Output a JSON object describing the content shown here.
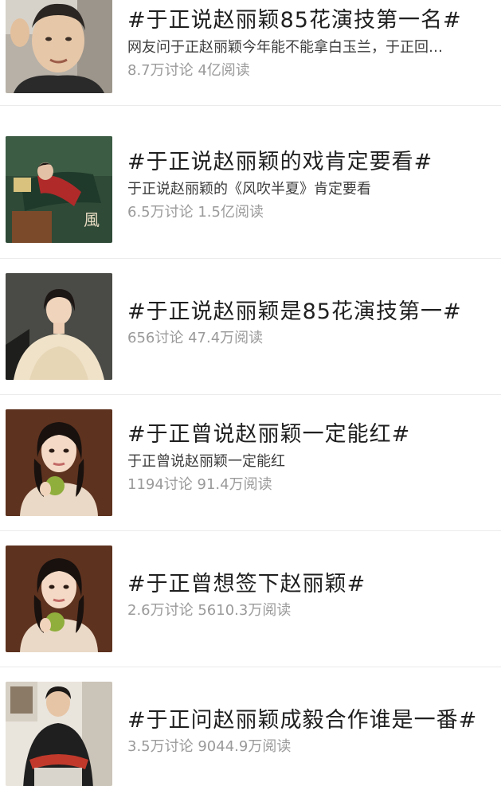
{
  "topics": [
    {
      "title": "#于正说赵丽颖85花演技第一名#",
      "desc": "网友问于正赵丽颖今年能不能拿白玉兰，于正回…",
      "stats": "8.7万讨论 4亿阅读",
      "thumb": "portrait-man-selfie"
    },
    {
      "title": "#于正说赵丽颖的戏肯定要看#",
      "desc": "于正说赵丽颖的《风吹半夏》肯定要看",
      "stats": "6.5万讨论 1.5亿阅读",
      "thumb": "drama-poster"
    },
    {
      "title": "#于正说赵丽颖是85花演技第一#",
      "desc": "",
      "stats": "656讨论 47.4万阅读",
      "thumb": "actress-white-dress"
    },
    {
      "title": "#于正曾说赵丽颖一定能红#",
      "desc": "于正曾说赵丽颖一定能红",
      "stats": "1194讨论 91.4万阅读",
      "thumb": "actress-holding-fruit"
    },
    {
      "title": "#于正曾想签下赵丽颖#",
      "desc": "",
      "stats": "2.6万讨论 5610.3万阅读",
      "thumb": "actress-holding-fruit"
    },
    {
      "title": "#于正问赵丽颖成毅合作谁是一番#",
      "desc": "",
      "stats": "3.5万讨论 9044.9万阅读",
      "thumb": "man-seated-interview"
    }
  ]
}
